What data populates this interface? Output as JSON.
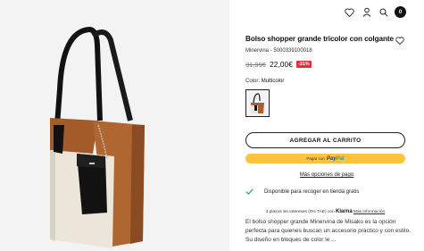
{
  "header": {
    "icons": [
      "heart-icon",
      "user-icon",
      "search-icon",
      "cart-icon"
    ],
    "cart_count": "0"
  },
  "product": {
    "title": "Bolso shopper grande tricolor con colgante",
    "reference": "Minervina - 5000339100018",
    "price_old": "31,99€",
    "price_new": "22,00€",
    "discount": "-31%",
    "color_label": "Color:",
    "color_value": "Multicolor",
    "add_to_cart": "AGREGAR AL CARRITO",
    "paypal_text": "Pagar con",
    "paypal_brand_a": "Pay",
    "paypal_brand_b": "Pal",
    "more_payment": "Más opciones de pago",
    "availability": "Disponible para recoger en tienda gratis",
    "klarna_text": "3 plazos sin intereses (0% TAE) con",
    "klarna_brand": "Klarna",
    "klarna_more": "Más información",
    "description": "El bolso shopper grande Minervina de Misako es la opción perfecta para quienes buscan un accesorio práctico y con estilo. Su diseño en bloques de color le ..."
  },
  "colors": {
    "brown": "#a9612f",
    "cream": "#ece5da",
    "black": "#151515",
    "paypal_yellow": "#ffc439",
    "discount_red": "#e0313b",
    "check_green": "#2a9d5c"
  }
}
